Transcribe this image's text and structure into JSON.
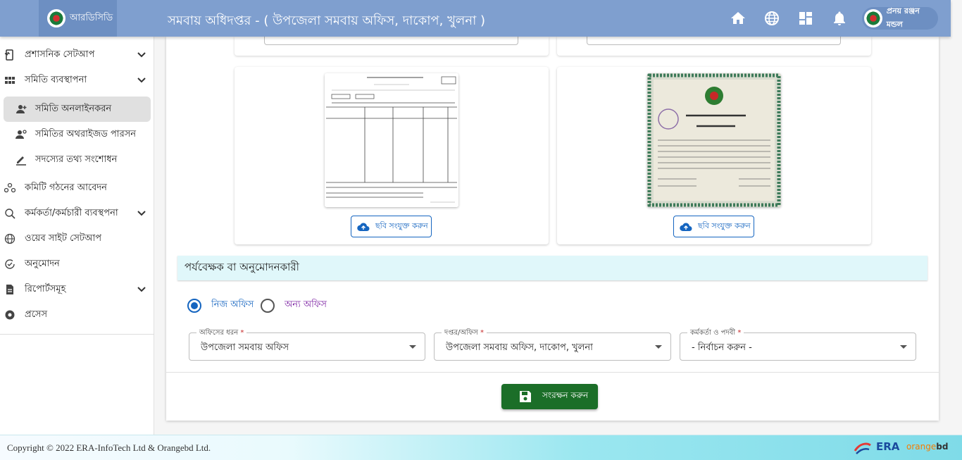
{
  "header": {
    "brand_label": "আরডিসিডি",
    "title": "সমবায় অধিদপ্তর - ( উপজেলা সমবায় অফিস, দাকোপ, খুলনা )",
    "user_name": "প্রনয় রঞ্জন মন্ডল",
    "icons": [
      "home-icon",
      "globe-icon",
      "dashboard-icon",
      "bell-icon"
    ]
  },
  "sidebar": {
    "items": [
      {
        "label": "প্রশাসনিক সেটআপ",
        "icon": "admin-setup-icon"
      },
      {
        "label": "সমিতি ব্যবস্থাপনা",
        "icon": "grid-icon"
      },
      {
        "label": "সমিতি অনলাইনকরন",
        "icon": "person-add-icon"
      },
      {
        "label": "সমিতির অথরাইজড পারসন",
        "icon": "authorized-person-icon"
      },
      {
        "label": "সদস্যের তথ্য সংশোধন",
        "icon": "edit-icon"
      },
      {
        "label": "কমিটি গঠনের আবেদন",
        "icon": "committee-icon"
      },
      {
        "label": "কর্মকর্তা/কর্মচারী ব্যবস্থপনা",
        "icon": "staff-icon"
      },
      {
        "label": "ওয়েব সাইট সেটআপ",
        "icon": "globe-icon"
      },
      {
        "label": "অনুমোদন",
        "icon": "approval-icon"
      },
      {
        "label": "রিপোর্টসমূহ",
        "icon": "report-icon"
      },
      {
        "label": "প্রসেস",
        "icon": "process-icon"
      }
    ]
  },
  "documents": {
    "upload_label_left": "ছবি সংযুক্ত করুন",
    "upload_label_right": "ছবি সংযুক্ত করুন"
  },
  "approver": {
    "section_title": "পর্যবেক্ষক বা অনুমোদনকারী",
    "radio_own": "নিজ অফিস",
    "radio_other": "অন্য অফিস",
    "selected_radio": "নিজ অফিস",
    "fields": [
      {
        "label": "অফিসের ধরন",
        "value": "উপজেলা সমবায় অফিস"
      },
      {
        "label": "দপ্তর/অফিস",
        "value": "উপজেলা সমবায় অফিস, দাকোপ, খুলনা"
      },
      {
        "label": "কর্মকর্তা ও পদবী",
        "value": "- নির্বাচন করুন -"
      }
    ],
    "required_mark": "*"
  },
  "actions": {
    "save_label": "সংরক্ষন করুন"
  },
  "footer": {
    "copyright": "Copyright © 2022 ERA-InfoTech Ltd & Orangebd Ltd.",
    "era_logo": "ERA",
    "orange_logo_a": "orange",
    "orange_logo_b": "bd"
  },
  "colors": {
    "header_bg": "#7f9fcf",
    "primary": "#1565c0",
    "save_bg": "#1b6e28",
    "section_bg": "#e0f7fa"
  }
}
